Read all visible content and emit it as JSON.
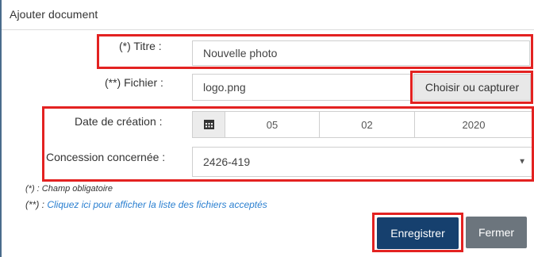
{
  "header": {
    "title": "Ajouter document"
  },
  "form": {
    "titre": {
      "label": "(*) Titre :",
      "value": "Nouvelle photo"
    },
    "fichier": {
      "label": "(**) Fichier :",
      "value": "logo.png",
      "button_label": "Choisir ou capturer"
    },
    "date_creation": {
      "label": "Date de création :",
      "day": "05",
      "month": "02",
      "year": "2020"
    },
    "concession": {
      "label": "Concession concernée :",
      "selected": "2426-419"
    }
  },
  "notes": {
    "required": "(*) : Champ obligatoire",
    "files_prefix": "(**) : ",
    "files_link": "Cliquez ici pour afficher la liste des fichiers acceptés"
  },
  "actions": {
    "save_label": "Enregistrer",
    "close_label": "Fermer"
  },
  "colors": {
    "highlight": "#e32221",
    "primary": "#16406e",
    "secondary": "#6c757d",
    "link": "#2a7fd0"
  }
}
